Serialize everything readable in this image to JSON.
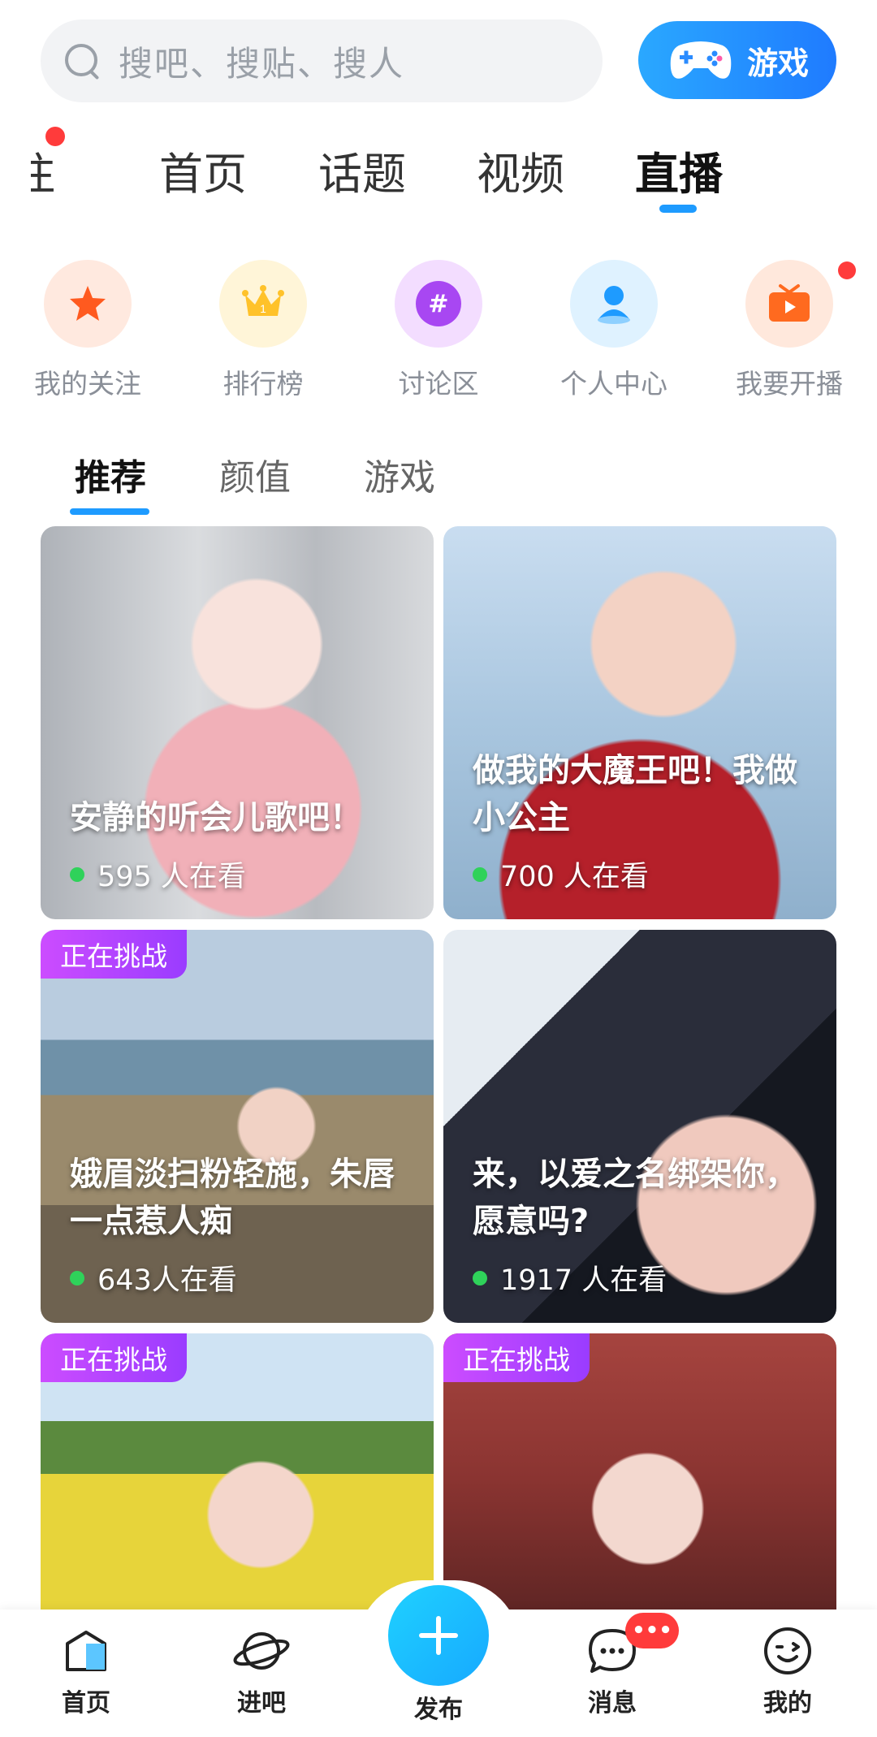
{
  "search": {
    "placeholder": "搜吧、搜贴、搜人"
  },
  "game_button": {
    "label": "游戏"
  },
  "top_tabs": [
    {
      "label": "关注",
      "shown": "注"
    },
    {
      "label": "首页"
    },
    {
      "label": "话题"
    },
    {
      "label": "视频"
    },
    {
      "label": "直播",
      "active": true
    }
  ],
  "shortcuts": [
    {
      "label": "我的关注",
      "icon": "star-icon",
      "color": "#ff6a2c"
    },
    {
      "label": "排行榜",
      "icon": "crown-icon",
      "color": "#ffc22a"
    },
    {
      "label": "讨论区",
      "icon": "hashtag-icon",
      "color": "#a847f2"
    },
    {
      "label": "个人中心",
      "icon": "user-icon",
      "color": "#1e9bff"
    },
    {
      "label": "我要开播",
      "icon": "tv-icon",
      "color": "#ff7a2c"
    }
  ],
  "sub_tabs": [
    {
      "label": "推荐",
      "active": true
    },
    {
      "label": "颜值"
    },
    {
      "label": "游戏"
    }
  ],
  "cards": [
    {
      "title": "安静的听会儿歌吧！",
      "viewers": "595 人在看",
      "tag": ""
    },
    {
      "title": "做我的大魔王吧！我做小公主",
      "viewers": "700 人在看",
      "tag": ""
    },
    {
      "title": "娥眉淡扫粉轻施，朱唇一点惹人痴",
      "viewers": "643人在看",
      "tag": "正在挑战"
    },
    {
      "title": "来，以爱之名绑架你，愿意吗?",
      "viewers": "1917 人在看",
      "tag": ""
    },
    {
      "title": "",
      "viewers": "",
      "tag": "正在挑战"
    },
    {
      "title": "",
      "viewers": "",
      "tag": "正在挑战"
    }
  ],
  "bottom_nav": {
    "home": "首页",
    "explore": "进吧",
    "publish": "发布",
    "messages": "消息",
    "mine": "我的",
    "messages_badge": "•••"
  },
  "colors": {
    "accent": "#1e9bff",
    "live": "#2fd25a",
    "badge": "#ff3b3b",
    "tag": "#b545ff"
  }
}
